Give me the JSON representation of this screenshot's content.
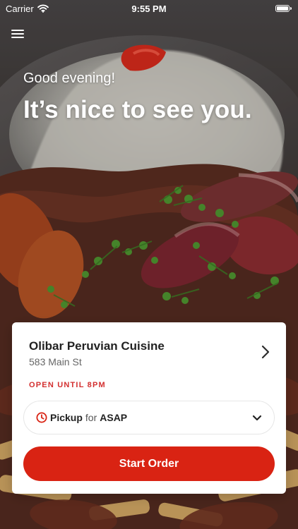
{
  "status_bar": {
    "carrier": "Carrier",
    "time": "9:55 PM",
    "wifi_icon": "wifi-icon",
    "battery_icon": "battery-icon"
  },
  "navigation": {
    "menu_icon": "hamburger-menu-icon"
  },
  "hero": {
    "greeting": "Good evening!",
    "headline": "It’s nice to see you."
  },
  "restaurant": {
    "name": "Olibar Peruvian Cuisine",
    "address": "583 Main St",
    "hours_status": "OPEN UNTIL 8PM",
    "chevron_icon": "chevron-right-icon"
  },
  "order": {
    "type": "Pickup",
    "connector": "for",
    "time": "ASAP",
    "clock_icon": "clock-icon",
    "dropdown_icon": "chevron-down-icon",
    "button_label": "Start Order"
  },
  "colors": {
    "accent": "#d92313",
    "status_red": "#d32f2f",
    "card": "#ffffff",
    "text_primary": "#222222",
    "text_secondary": "#666666"
  }
}
